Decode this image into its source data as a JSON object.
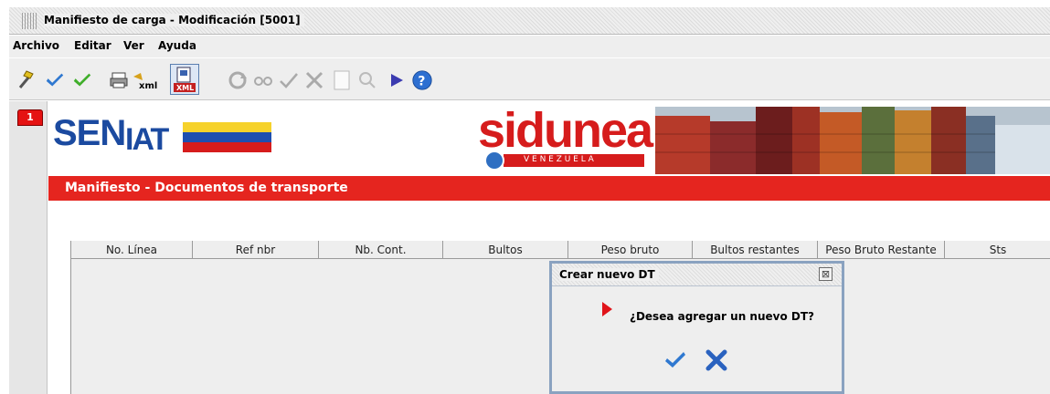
{
  "window": {
    "title": "Manifiesto de carga - Modificación [5001]"
  },
  "menu": {
    "items": [
      "Archivo",
      "Editar",
      "Ver",
      "Ayuda"
    ]
  },
  "toolbar": {
    "icons": [
      "magic-wand-icon",
      "validate-check-icon",
      "confirm-check-icon",
      "print-icon",
      "xml-export-icon",
      "xml-document-icon",
      "refresh-icon",
      "view-icon",
      "verify-icon",
      "delete-icon",
      "page-icon",
      "search-icon",
      "run-icon",
      "help-icon"
    ]
  },
  "tab": {
    "number": "1"
  },
  "banner": {
    "logo_left": "SENIAT",
    "logo_right": "sidunea",
    "logo_right_sub": "V E N E Z U E L A"
  },
  "section": {
    "title": "Manifiesto - Documentos de transporte"
  },
  "table": {
    "columns": [
      "No. Línea",
      "Ref nbr",
      "Nb. Cont.",
      "Bultos",
      "Peso bruto",
      "Bultos restantes",
      "Peso Bruto Restante",
      "Sts"
    ]
  },
  "dialog": {
    "title": "Crear nuevo DT",
    "message": "¿Desea agregar un nuevo DT?",
    "ok_icon": "confirm-check-icon",
    "cancel_icon": "cancel-x-icon"
  },
  "colors": {
    "accent_red": "#e5251f",
    "blue": "#1b4aa0",
    "dialog_border": "#8aa2c0"
  }
}
